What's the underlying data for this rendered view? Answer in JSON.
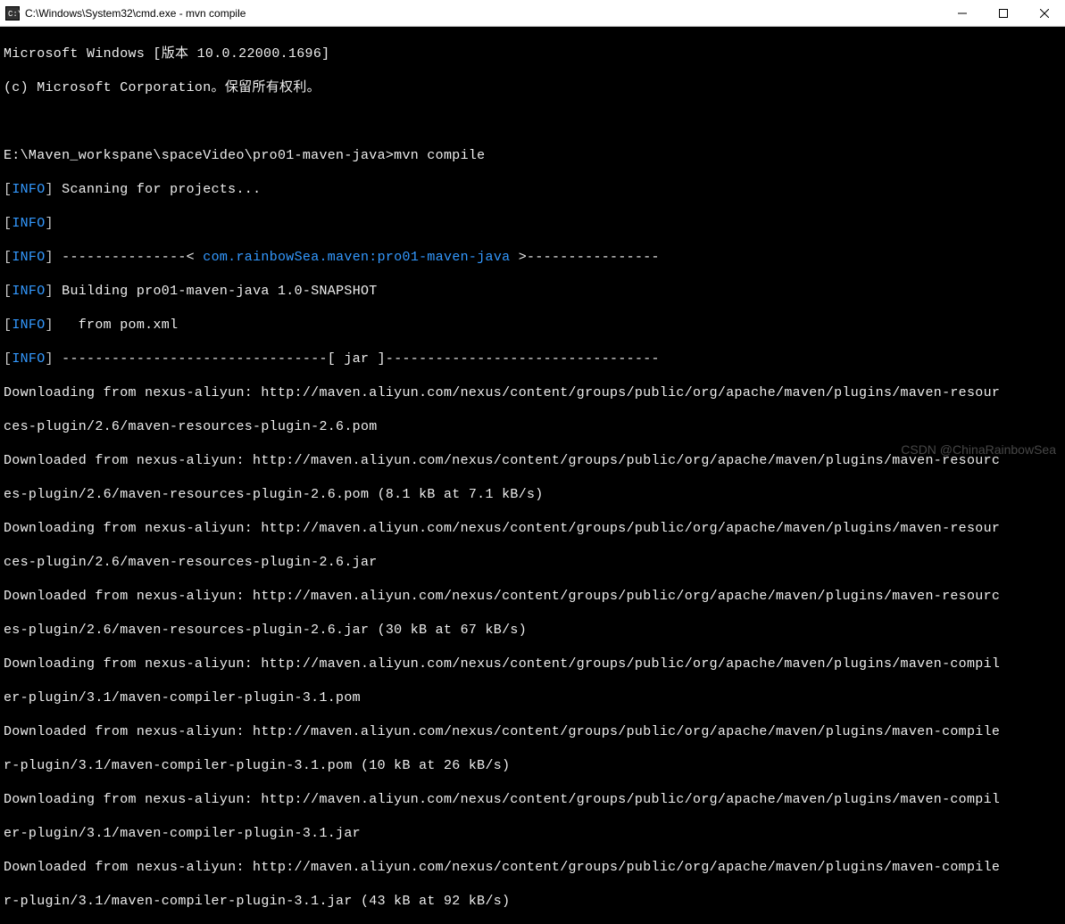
{
  "titlebar": {
    "title": "C:\\Windows\\System32\\cmd.exe - mvn  compile"
  },
  "terminal": {
    "header1": "Microsoft Windows [版本 10.0.22000.1696]",
    "header2": "(c) Microsoft Corporation。保留所有权利。",
    "promptLine": "E:\\Maven_workspane\\spaceVideo\\pro01-maven-java>mvn compile",
    "infoLabel": "INFO",
    "scanLine": " Scanning for projects...",
    "dashLeft": " ---------------< ",
    "artifact": "com.rainbowSea.maven:pro01-maven-java",
    "dashRight": " >----------------",
    "buildLine": " Building pro01-maven-java 1.0-SNAPSHOT",
    "fromPom": "   from pom.xml",
    "jarLine": " --------------------------------[ jar ]---------------------------------",
    "dl1a": "Downloading from nexus-aliyun: http://maven.aliyun.com/nexus/content/groups/public/org/apache/maven/plugins/maven-resour",
    "dl1b": "ces-plugin/2.6/maven-resources-plugin-2.6.pom",
    "dl2a": "Downloaded from nexus-aliyun: http://maven.aliyun.com/nexus/content/groups/public/org/apache/maven/plugins/maven-resourc",
    "dl2b": "es-plugin/2.6/maven-resources-plugin-2.6.pom (8.1 kB at 7.1 kB/s)",
    "dl3a": "Downloading from nexus-aliyun: http://maven.aliyun.com/nexus/content/groups/public/org/apache/maven/plugins/maven-resour",
    "dl3b": "ces-plugin/2.6/maven-resources-plugin-2.6.jar",
    "dl4a": "Downloaded from nexus-aliyun: http://maven.aliyun.com/nexus/content/groups/public/org/apache/maven/plugins/maven-resourc",
    "dl4b": "es-plugin/2.6/maven-resources-plugin-2.6.jar (30 kB at 67 kB/s)",
    "dl5a": "Downloading from nexus-aliyun: http://maven.aliyun.com/nexus/content/groups/public/org/apache/maven/plugins/maven-compil",
    "dl5b": "er-plugin/3.1/maven-compiler-plugin-3.1.pom",
    "dl6a": "Downloaded from nexus-aliyun: http://maven.aliyun.com/nexus/content/groups/public/org/apache/maven/plugins/maven-compile",
    "dl6b": "r-plugin/3.1/maven-compiler-plugin-3.1.pom (10 kB at 26 kB/s)",
    "dl7a": "Downloading from nexus-aliyun: http://maven.aliyun.com/nexus/content/groups/public/org/apache/maven/plugins/maven-compil",
    "dl7b": "er-plugin/3.1/maven-compiler-plugin-3.1.jar",
    "dl8a": "Downloaded from nexus-aliyun: http://maven.aliyun.com/nexus/content/groups/public/org/apache/maven/plugins/maven-compile",
    "dl8b": "r-plugin/3.1/maven-compiler-plugin-3.1.jar (43 kB at 92 kB/s)"
  },
  "watermark": "CSDN @ChinaRainbowSea"
}
